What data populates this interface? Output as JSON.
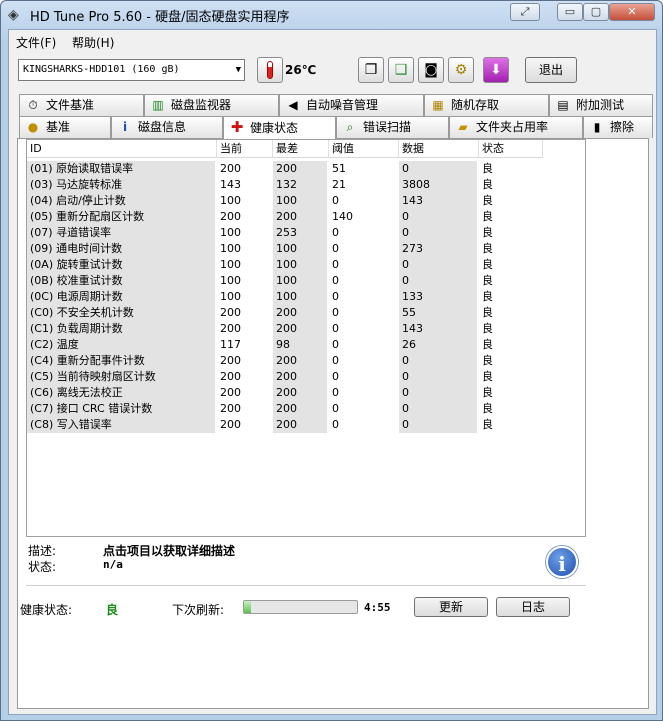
{
  "window": {
    "title": "HD Tune Pro 5.60 - 硬盘/固态硬盘实用程序",
    "min": "▭",
    "max": "▢",
    "close": "✕",
    "restore": "⤢"
  },
  "menu": {
    "file": "文件(F)",
    "help": "帮助(H)"
  },
  "toolbar": {
    "drive": "KINGSHARKS-HDD101 (160 gB)",
    "temperature": "26℃",
    "exit_label": "退出"
  },
  "tabs_top": [
    "文件基准",
    "磁盘监视器",
    "自动噪音管理",
    "随机存取",
    "附加测试"
  ],
  "tabs_bottom": [
    "基准",
    "磁盘信息",
    "健康状态",
    "错误扫描",
    "文件夹占用率",
    "擦除"
  ],
  "columns": [
    "ID",
    "当前",
    "最差",
    "阈值",
    "数据",
    "状态"
  ],
  "rows": [
    [
      "(01) 原始读取错误率",
      "200",
      "200",
      "51",
      "0",
      "良"
    ],
    [
      "(03) 马达旋转标准",
      "143",
      "132",
      "21",
      "3808",
      "良"
    ],
    [
      "(04) 启动/停止计数",
      "100",
      "100",
      "0",
      "143",
      "良"
    ],
    [
      "(05) 重新分配扇区计数",
      "200",
      "200",
      "140",
      "0",
      "良"
    ],
    [
      "(07) 寻道错误率",
      "100",
      "253",
      "0",
      "0",
      "良"
    ],
    [
      "(09) 通电时间计数",
      "100",
      "100",
      "0",
      "273",
      "良"
    ],
    [
      "(0A) 旋转重试计数",
      "100",
      "100",
      "0",
      "0",
      "良"
    ],
    [
      "(0B) 校准重试计数",
      "100",
      "100",
      "0",
      "0",
      "良"
    ],
    [
      "(0C) 电源周期计数",
      "100",
      "100",
      "0",
      "133",
      "良"
    ],
    [
      "(C0) 不安全关机计数",
      "200",
      "200",
      "0",
      "55",
      "良"
    ],
    [
      "(C1) 负载周期计数",
      "200",
      "200",
      "0",
      "143",
      "良"
    ],
    [
      "(C2) 温度",
      "117",
      "98",
      "0",
      "26",
      "良"
    ],
    [
      "(C4) 重新分配事件计数",
      "200",
      "200",
      "0",
      "0",
      "良"
    ],
    [
      "(C5) 当前待映射扇区计数",
      "200",
      "200",
      "0",
      "0",
      "良"
    ],
    [
      "(C6) 离线无法校正",
      "200",
      "200",
      "0",
      "0",
      "良"
    ],
    [
      "(C7) 接口 CRC 错误计数",
      "200",
      "200",
      "0",
      "0",
      "良"
    ],
    [
      "(C8) 写入错误率",
      "200",
      "200",
      "0",
      "0",
      "良"
    ]
  ],
  "description": {
    "desc_label": "描述:",
    "desc_value": "点击项目以获取详细描述",
    "status_label": "状态:",
    "status_value": "n/a"
  },
  "footer": {
    "health_label": "健康状态:",
    "health_value": "良",
    "refresh_label": "下次刷新:",
    "refresh_time": "4:55",
    "refresh_progress": 0.06,
    "update_button": "更新",
    "log_button": "日志"
  }
}
